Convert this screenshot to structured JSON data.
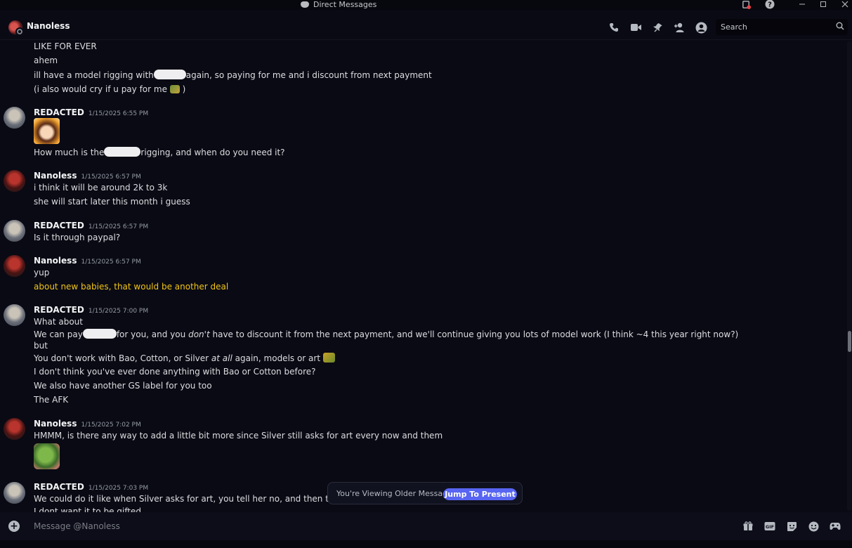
{
  "window": {
    "title": "Direct Messages",
    "controls": [
      "minimize-icon",
      "maximize-icon",
      "close-icon"
    ]
  },
  "header": {
    "name": "Nanoless",
    "icons": [
      "call-icon",
      "video-icon",
      "pin-icon",
      "add-friend-icon",
      "profile-icon"
    ],
    "search": {
      "placeholder": "Search"
    }
  },
  "messages": {
    "top_lines": [
      "LIKE FOR EVER",
      "ahem",
      {
        "a": "ill have a model rigging with",
        "b": "again, so paying for me and i discount from next payment"
      },
      {
        "a": "(i also would cry if u pay for me",
        "b": ")"
      }
    ],
    "g1": {
      "author": "REDACTED",
      "ts": "1/15/2025 6:55 PM",
      "l1": {
        "a": "How much is the",
        "b": "rigging, and when do you need it?"
      }
    },
    "g2": {
      "author": "Nanoless",
      "ts": "1/15/2025 6:57 PM",
      "l1": "i think it will be around 2k to 3k",
      "l2": "she will start later this month i guess"
    },
    "g3": {
      "author": "REDACTED",
      "ts": "1/15/2025 6:57 PM",
      "l1": "Is it through paypal?"
    },
    "g4": {
      "author": "Nanoless",
      "ts": "1/15/2025 6:57 PM",
      "l1": "yup",
      "l2": "about new babies, that would be another deal"
    },
    "g5": {
      "author": "REDACTED",
      "ts": "1/15/2025 7:00 PM",
      "l1": "What about",
      "l2": {
        "a": "We can pay",
        "b": "for you, and you",
        "c": "don't",
        "d": "have to discount it from the next payment, and we'll continue giving you lots of model work (I think ~4 this year right now?)"
      },
      "l3": "but",
      "l4": {
        "a": "You don't work with Bao, Cotton, or Silver",
        "b": "at all",
        "c": "again, models or art"
      },
      "l5": "I don't think you've ever done anything with Bao or Cotton before?",
      "l6": "We also have another GS label for you too",
      "l7": "The AFK"
    },
    "g6": {
      "author": "Nanoless",
      "ts": "1/15/2025 7:02 PM",
      "l1": "HMMM, is there any way to add a little bit more since Silver still asks for art every now and them"
    },
    "g7": {
      "author": "REDACTED",
      "ts": "1/15/2025 7:03 PM",
      "l1": "We could do it like when Silver asks for art, you tell her no, and then tell us to buy",
      "l2": "I dont want it to be gifted"
    }
  },
  "older_banner": {
    "text": "You're Viewing Older Messages",
    "button": "Jump To Present"
  },
  "composer": {
    "placeholder": "Message @Nanoless",
    "icons": [
      "upload-plus-icon",
      "gift-icon",
      "gif-icon",
      "sticker-icon",
      "emoji-icon",
      "activities-icon"
    ]
  },
  "colors": {
    "accent": "#5865f2",
    "highlight_text": "#f0c419",
    "background": "#0a0a14"
  }
}
